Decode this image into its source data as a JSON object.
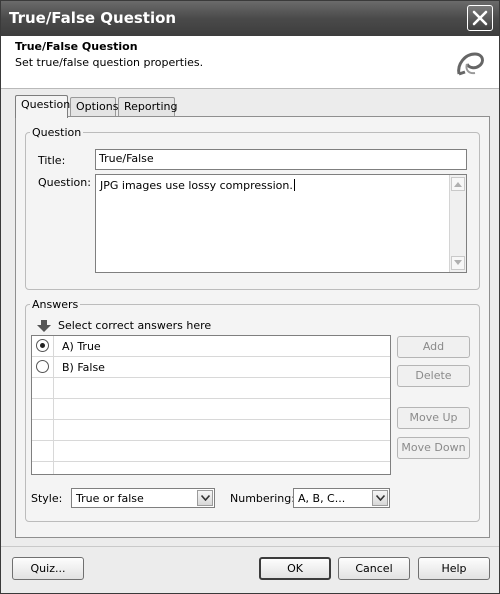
{
  "window": {
    "title": "True/False Question"
  },
  "header": {
    "title": "True/False Question",
    "subtitle": "Set true/false question properties."
  },
  "tabs": [
    {
      "label": "Question",
      "active": true
    },
    {
      "label": "Options",
      "active": false
    },
    {
      "label": "Reporting",
      "active": false
    }
  ],
  "question_group": {
    "legend": "Question",
    "title_label": "Title:",
    "title_value": "True/False",
    "question_label": "Question:",
    "question_value": "JPG images use lossy compression."
  },
  "answers_group": {
    "legend": "Answers",
    "hint": "Select correct answers here",
    "rows": [
      {
        "text": "A) True",
        "selected": true
      },
      {
        "text": "B) False",
        "selected": false
      }
    ],
    "buttons": {
      "add": "Add",
      "delete": "Delete",
      "move_up": "Move Up",
      "move_down": "Move Down"
    },
    "style_label": "Style:",
    "style_value": "True or false",
    "numbering_label": "Numbering:",
    "numbering_value": "A, B, C..."
  },
  "footer": {
    "quiz": "Quiz...",
    "ok": "OK",
    "cancel": "Cancel",
    "help": "Help"
  },
  "icons": {
    "close": "close-icon",
    "logo": "app-logo-icon",
    "arrow": "down-arrow-icon",
    "dropdown": "chevron-down-icon"
  }
}
